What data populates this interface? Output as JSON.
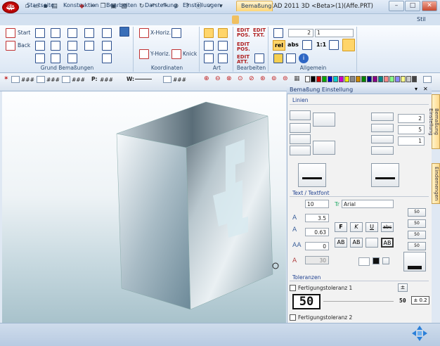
{
  "window": {
    "title": "MegaCAD 2011 3D <Beta>(1)(Affe.PRT)",
    "logo_text": "MEGA CAD",
    "controls": [
      "–",
      "□",
      "✕"
    ]
  },
  "tabs": [
    {
      "label": "Startseite"
    },
    {
      "label": "Konstruktion"
    },
    {
      "label": "Bearbeiten"
    },
    {
      "label": "Darstellung"
    },
    {
      "label": "Einstellungen"
    },
    {
      "label": "Bemaßung"
    }
  ],
  "style_label": "Stil",
  "ribbon": {
    "groups": [
      {
        "label": "Grund Bemaßungen",
        "buttons": [
          "Start",
          "Back"
        ]
      },
      {
        "label": "Koordinaten",
        "buttons": [
          "X-Horiz.",
          "Y-Horiz.",
          "Knick"
        ]
      },
      {
        "label": "Art"
      },
      {
        "label": "Bearbeiten",
        "buttons": [
          "EDIT POS.",
          "EDIT TXT.",
          "EDIT POS.",
          "EDIT ATT."
        ]
      },
      {
        "label": "Allgemein",
        "selects": [
          "2",
          "1"
        ],
        "buttons": [
          "rel",
          "abs",
          "1:1"
        ]
      }
    ]
  },
  "toolbar": {
    "fields": [
      "###",
      "###",
      "###",
      "###",
      "###"
    ],
    "p_label": "P:",
    "w_label": "W:"
  },
  "panel": {
    "title": "Bemaßung Einstellung",
    "sections": {
      "linien": "Linien",
      "text": "Text / Textfont",
      "toleranzen": "Toleranzen"
    },
    "line_values": [
      "2",
      "5",
      "1"
    ],
    "text": {
      "size": "10",
      "font": "Arial",
      "height": "3.5",
      "width": "0.63",
      "spacing": "0",
      "angle": "30",
      "styles": [
        "F",
        "K",
        "U",
        "abc",
        "AB",
        "AB",
        "",
        "AB"
      ]
    },
    "tolerances": {
      "checkbox1": "Fertigungstoleranz 1",
      "checkbox2": "Fertigungstoleranz 2",
      "preview_value": "50",
      "preview_small": "50",
      "tolerance": "± 0.2"
    },
    "right_buttons": [
      "50",
      "50",
      "50",
      "50"
    ],
    "side_tabs": [
      "Bemaßung Einstellung",
      "Eindemengen"
    ]
  },
  "colors": {
    "accent": "#ffd56a",
    "ribbon_bg": "#dce7f4",
    "panel_section": "#1d3f8f"
  }
}
